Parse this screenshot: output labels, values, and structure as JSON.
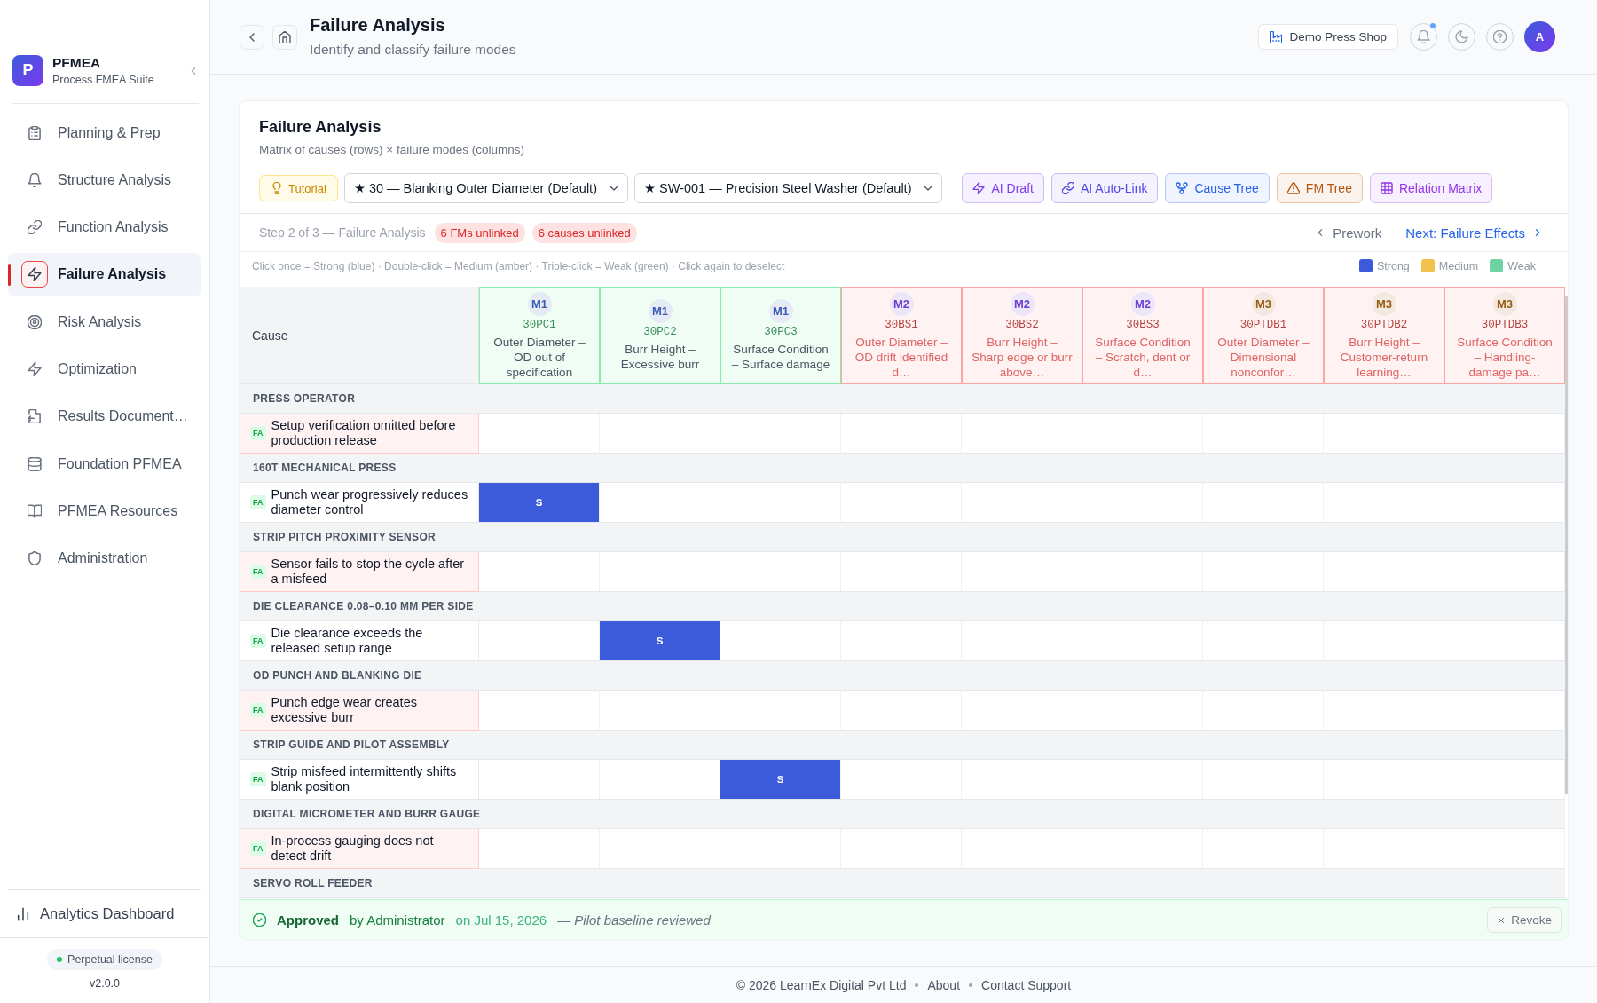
{
  "sidebar": {
    "brand": {
      "logo": "P",
      "title": "PFMEA",
      "subtitle": "Process FMEA Suite"
    },
    "items": [
      {
        "label": "Planning & Prep",
        "selected": false
      },
      {
        "label": "Structure Analysis",
        "selected": false
      },
      {
        "label": "Function Analysis",
        "selected": false
      },
      {
        "label": "Failure Analysis",
        "selected": true
      },
      {
        "label": "Risk Analysis",
        "selected": false
      },
      {
        "label": "Optimization",
        "selected": false
      },
      {
        "label": "Results Document…",
        "selected": false
      },
      {
        "label": "Foundation PFMEA",
        "selected": false
      },
      {
        "label": "PFMEA Resources",
        "selected": false
      },
      {
        "label": "Administration",
        "selected": false
      }
    ],
    "footer_link": "Analytics Dashboard",
    "license": "Perpetual license",
    "version": "v2.0.0"
  },
  "header": {
    "title": "Failure Analysis",
    "subtitle": "Identify and classify failure modes",
    "workspace": "Demo Press Shop",
    "unread_notifications": true,
    "avatar": "A"
  },
  "panel": {
    "title": "Failure Analysis",
    "subtitle": "Matrix of causes (rows) × failure modes (columns)",
    "tutorial": "Tutorial",
    "selects": [
      {
        "value": "★ 30 — Blanking Outer Diameter (Default)"
      },
      {
        "value": "★ SW-001 — Precision Steel Washer (Default)"
      }
    ],
    "actions": [
      {
        "label": "AI Draft",
        "color": "#7c3aed"
      },
      {
        "label": "AI Auto-Link",
        "color": "#4f46e5"
      },
      {
        "label": "Cause Tree",
        "color": "#2563eb"
      },
      {
        "label": "FM Tree",
        "color": "#b45309"
      },
      {
        "label": "Relation Matrix",
        "color": "#9333ea"
      }
    ],
    "step": "Step 2 of 3 — Failure Analysis",
    "issues": [
      "6 FMs unlinked",
      "6 causes unlinked"
    ],
    "prev": "Prework",
    "next": "Next: Failure Effects",
    "hint": "Click once = Strong (blue) · Double-click = Medium (amber) · Triple-click = Weak (green) · Click again to deselect",
    "legend": [
      {
        "kind": "strong",
        "label": "Strong",
        "color": "#3b5bdb"
      },
      {
        "kind": "medium",
        "label": "Medium",
        "color": "#f2c14e"
      },
      {
        "kind": "weak",
        "label": "Weak",
        "color": "#6fd3a1"
      }
    ]
  },
  "matrix": {
    "corner": "Cause",
    "failure_modes": [
      {
        "badge": "M1",
        "color": "#3b5bb5",
        "code": "30PC1",
        "name": "Outer Diameter – OD out of specification",
        "linked": true
      },
      {
        "badge": "M1",
        "color": "#3b5bb5",
        "code": "30PC2",
        "name": "Burr Height – Excessive burr",
        "linked": true
      },
      {
        "badge": "M1",
        "color": "#3b5bb5",
        "code": "30PC3",
        "name": "Surface Condition – Surface damage",
        "linked": true
      },
      {
        "badge": "M2",
        "color": "#6d3fd0",
        "code": "30BS1",
        "name": "Outer Diameter – OD drift identified d…",
        "linked": false
      },
      {
        "badge": "M2",
        "color": "#6d3fd0",
        "code": "30BS2",
        "name": "Burr Height – Sharp edge or burr above…",
        "linked": false
      },
      {
        "badge": "M2",
        "color": "#6d3fd0",
        "code": "30BS3",
        "name": "Surface Condition – Scratch, dent or d…",
        "linked": false
      },
      {
        "badge": "M3",
        "color": "#9a5b12",
        "code": "30PTDB1",
        "name": "Outer Diameter – Dimensional nonconfor…",
        "linked": false
      },
      {
        "badge": "M3",
        "color": "#9a5b12",
        "code": "30PTDB2",
        "name": "Burr Height – Customer-return learning…",
        "linked": false
      },
      {
        "badge": "M3",
        "color": "#9a5b12",
        "code": "30PTDB3",
        "name": "Surface Condition – Handling-damage pa…",
        "linked": false
      }
    ],
    "groups": [
      {
        "name": "PRESS OPERATOR",
        "causes": [
          {
            "tag": "FA",
            "text": "Setup verification omitted before production release",
            "linked": false,
            "cells": [
              {
                "kind": "none"
              },
              {
                "kind": "none"
              },
              {
                "kind": "none"
              },
              {
                "kind": "none"
              },
              {
                "kind": "none"
              },
              {
                "kind": "none"
              },
              {
                "kind": "none"
              },
              {
                "kind": "none"
              },
              {
                "kind": "none"
              }
            ]
          }
        ]
      },
      {
        "name": "160T MECHANICAL PRESS",
        "causes": [
          {
            "tag": "FA",
            "text": "Punch wear progressively reduces diameter control",
            "linked": true,
            "cells": [
              {
                "kind": "strong",
                "label": "S"
              },
              {
                "kind": "none"
              },
              {
                "kind": "none"
              },
              {
                "kind": "none"
              },
              {
                "kind": "none"
              },
              {
                "kind": "none"
              },
              {
                "kind": "none"
              },
              {
                "kind": "none"
              },
              {
                "kind": "none"
              }
            ]
          }
        ]
      },
      {
        "name": "STRIP PITCH PROXIMITY SENSOR",
        "causes": [
          {
            "tag": "FA",
            "text": "Sensor fails to stop the cycle after a misfeed",
            "linked": false,
            "cells": [
              {
                "kind": "none"
              },
              {
                "kind": "none"
              },
              {
                "kind": "none"
              },
              {
                "kind": "none"
              },
              {
                "kind": "none"
              },
              {
                "kind": "none"
              },
              {
                "kind": "none"
              },
              {
                "kind": "none"
              },
              {
                "kind": "none"
              }
            ]
          }
        ]
      },
      {
        "name": "DIE CLEARANCE 0.08–0.10 MM PER SIDE",
        "causes": [
          {
            "tag": "FA",
            "text": "Die clearance exceeds the released setup range",
            "linked": true,
            "cells": [
              {
                "kind": "none"
              },
              {
                "kind": "strong",
                "label": "S"
              },
              {
                "kind": "none"
              },
              {
                "kind": "none"
              },
              {
                "kind": "none"
              },
              {
                "kind": "none"
              },
              {
                "kind": "none"
              },
              {
                "kind": "none"
              },
              {
                "kind": "none"
              }
            ]
          }
        ]
      },
      {
        "name": "OD PUNCH AND BLANKING DIE",
        "causes": [
          {
            "tag": "FA",
            "text": "Punch edge wear creates excessive burr",
            "linked": false,
            "cells": [
              {
                "kind": "none"
              },
              {
                "kind": "none"
              },
              {
                "kind": "none"
              },
              {
                "kind": "none"
              },
              {
                "kind": "none"
              },
              {
                "kind": "none"
              },
              {
                "kind": "none"
              },
              {
                "kind": "none"
              },
              {
                "kind": "none"
              }
            ]
          }
        ]
      },
      {
        "name": "STRIP GUIDE AND PILOT ASSEMBLY",
        "causes": [
          {
            "tag": "FA",
            "text": "Strip misfeed intermittently shifts blank position",
            "linked": true,
            "cells": [
              {
                "kind": "none"
              },
              {
                "kind": "none"
              },
              {
                "kind": "strong",
                "label": "S"
              },
              {
                "kind": "none"
              },
              {
                "kind": "none"
              },
              {
                "kind": "none"
              },
              {
                "kind": "none"
              },
              {
                "kind": "none"
              },
              {
                "kind": "none"
              }
            ]
          }
        ]
      },
      {
        "name": "DIGITAL MICROMETER AND BURR GAUGE",
        "causes": [
          {
            "tag": "FA",
            "text": "In-process gauging does not detect drift",
            "linked": false,
            "cells": [
              {
                "kind": "none"
              },
              {
                "kind": "none"
              },
              {
                "kind": "none"
              },
              {
                "kind": "none"
              },
              {
                "kind": "none"
              },
              {
                "kind": "none"
              },
              {
                "kind": "none"
              },
              {
                "kind": "none"
              },
              {
                "kind": "none"
              }
            ]
          }
        ]
      },
      {
        "name": "SERVO ROLL FEEDER"
      }
    ]
  },
  "approval": {
    "status": "Approved",
    "by": "by Administrator",
    "date": "on Jul 15, 2026",
    "note": "— Pilot baseline reviewed",
    "action": "Revoke"
  },
  "footer": {
    "copyright": "© 2026 LearnEx Digital Pvt Ltd",
    "links": [
      "About",
      "Contact Support"
    ]
  }
}
